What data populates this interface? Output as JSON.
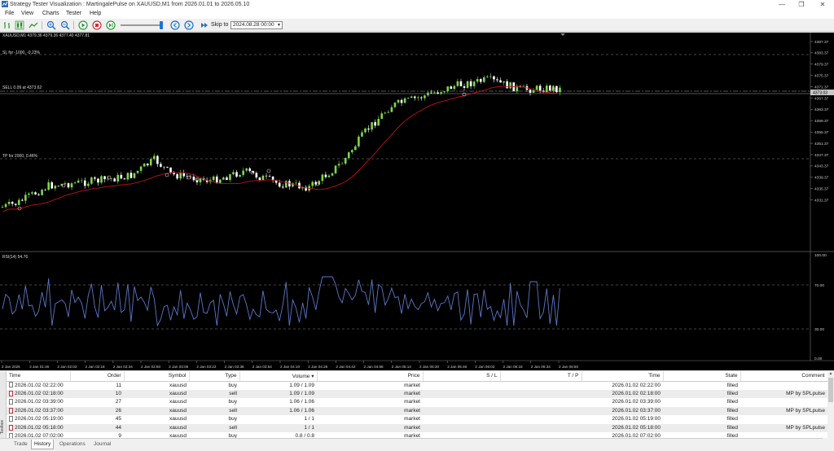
{
  "window": {
    "title": "Strategy Tester Visualization : MartingalePulse on XAUUSD,M1 from 2026.01.01 to 2026.05.10",
    "minimize": "—",
    "restore": "❐",
    "close": "✕"
  },
  "menu": [
    "File",
    "View",
    "Charts",
    "Tester",
    "Help"
  ],
  "toolbar": {
    "skip_label": "Skip to",
    "skip_value": "2024.08.28 00:00"
  },
  "chart": {
    "symbol_info": "XAUUSD,M1  4379.36  4379.36  4377.40  4377.81",
    "sl_label": "SL for -1000, -0.23%",
    "sell_label": "SELL 0.09 at 4373.62",
    "tp_label": "TP for 2000, 0.46%",
    "current_price": "4373.03",
    "price_ticks": [
      "4387.37",
      "4383.37",
      "4379.37",
      "4375.37",
      "4371.37",
      "4367.37",
      "4363.37",
      "4359.37",
      "4355.37",
      "4351.37",
      "4347.37",
      "4343.37",
      "4339.37",
      "4335.37",
      "4331.37"
    ],
    "rsi_label": "RSI(14) 54.76",
    "rsi_ticks": [
      "100.00",
      "70.00",
      "30.00",
      "0.00"
    ],
    "time_ticks": [
      "2 Jan 2026",
      "2 Jan 01:46",
      "2 Jan 02:02",
      "2 Jan 02:18",
      "2 Jan 02:34",
      "2 Jan 02:50",
      "2 Jan 03:06",
      "2 Jan 03:22",
      "2 Jan 03:38",
      "2 Jan 03:54",
      "2 Jan 04:10",
      "2 Jan 04:26",
      "2 Jan 04:42",
      "2 Jan 04:58",
      "2 Jan 05:14",
      "2 Jan 05:30",
      "2 Jan 05:46",
      "2 Jan 06:02",
      "2 Jan 06:18",
      "2 Jan 06:34",
      "2 Jan 06:50"
    ],
    "colors": {
      "bull": "#7cd84c",
      "bear": "#ffffff",
      "ma": "#c0121b",
      "rsi": "#5b78c8",
      "level": "#888888"
    }
  },
  "history": {
    "columns": [
      "Time",
      "Order",
      "Symbol",
      "Type",
      "Volume",
      "Price",
      "S / L",
      "T / P",
      "Time",
      "State",
      "Comment"
    ],
    "rows": [
      [
        "2026.01.02 02:22:00",
        "11",
        "xauusd",
        "buy",
        "1.09 / 1.09",
        "market",
        "",
        "",
        "2026.01.02 02:22:00",
        "filled",
        ""
      ],
      [
        "2026.01.02 02:18:00",
        "10",
        "xauusd",
        "sell",
        "1.09 / 1.09",
        "market",
        "",
        "",
        "2026.01.02 02:18:00",
        "filled",
        "MP by SPLpulse"
      ],
      [
        "2026.01.02 03:39:00",
        "27",
        "xauusd",
        "buy",
        "1.06 / 1.06",
        "market",
        "",
        "",
        "2026.01.02 03:39:00",
        "filled",
        ""
      ],
      [
        "2026.01.02 03:37:00",
        "26",
        "xauusd",
        "sell",
        "1.06 / 1.06",
        "market",
        "",
        "",
        "2026.01.02 03:37:00",
        "filled",
        "MP by SPLpulse"
      ],
      [
        "2026.01.02 05:19:00",
        "45",
        "xauusd",
        "buy",
        "1 / 1",
        "market",
        "",
        "",
        "2026.01.02 05:19:00",
        "filled",
        ""
      ],
      [
        "2026.01.02 05:18:00",
        "44",
        "xauusd",
        "sell",
        "1 / 1",
        "market",
        "",
        "",
        "2026.01.02 05:18:00",
        "filled",
        "MP by SPLpulse"
      ],
      [
        "2026.01.02 07:02:00",
        "9",
        "xauusd",
        "buy",
        "0.8 / 0.8",
        "market",
        "",
        "",
        "2026.01.02 07:02:00",
        "filled",
        ""
      ]
    ]
  },
  "tabs": [
    "Trade",
    "History",
    "Operations",
    "Journal"
  ],
  "active_tab": "History",
  "toolbox_label": "Toolbox"
}
